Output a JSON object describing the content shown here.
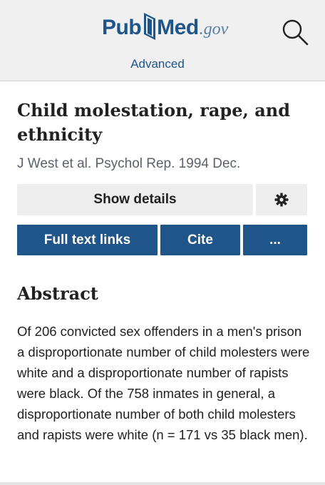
{
  "header": {
    "logo": {
      "pub": "Pub",
      "med": "Med",
      "gov": ".gov"
    },
    "search_icon": "search-icon",
    "advanced_link": "Advanced"
  },
  "article": {
    "title": "Child molestation, rape, and ethnicity",
    "citation": "J West et al. Psychol Rep. 1994 Dec."
  },
  "actions": {
    "show_details": "Show details",
    "settings_icon": "gear-icon",
    "full_text_links": "Full text links",
    "cite": "Cite",
    "more": "..."
  },
  "abstract": {
    "heading": "Abstract",
    "text": "Of 206 convicted sex offenders in a men's prison a disproportionate number of child molesters were white and a disproportionate number of rapists were black. Of the 758 inmates in general, a disproportionate number of both child molesters and rapists were white (n = 171 vs 35 black men)."
  },
  "colors": {
    "brand_blue": "#20558a",
    "header_bg": "#f0f0f0",
    "button_grey": "#eeeeee",
    "text": "#212121",
    "muted_text": "#5b616b"
  }
}
